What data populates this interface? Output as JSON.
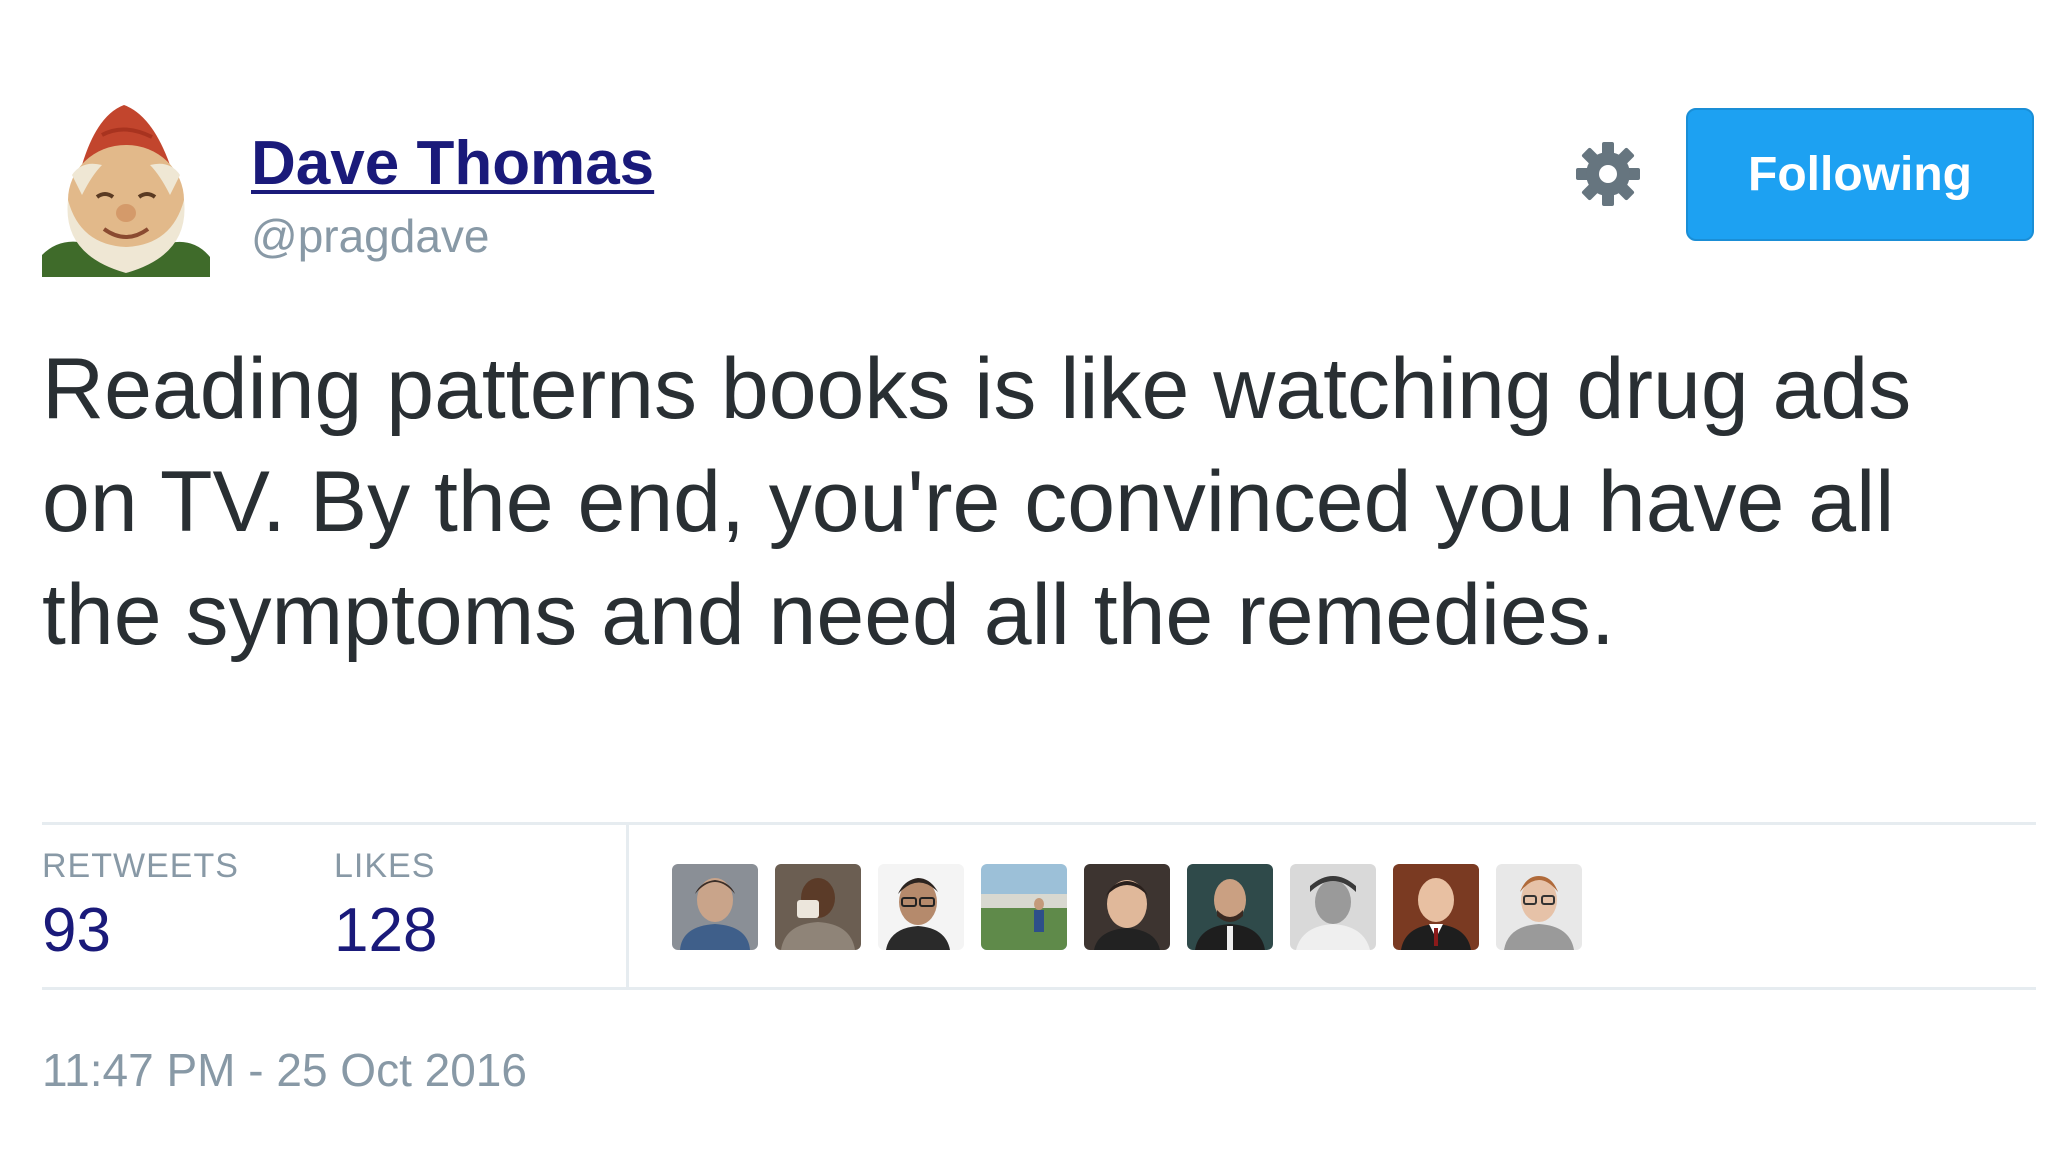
{
  "author": {
    "display_name": "Dave Thomas",
    "handle": "@pragdave",
    "avatar_icon": "garden-gnome-avatar"
  },
  "header": {
    "settings_icon": "gear-icon",
    "follow_button_label": "Following",
    "follow_button_color": "#1da1f2"
  },
  "tweet": {
    "text": "Reading patterns books is like watching drug ads on TV. By the end, you're convinced you have all the symptoms and need all the remedies."
  },
  "stats": {
    "retweets_label": "RETWEETS",
    "retweets_count": "93",
    "likes_label": "LIKES",
    "likes_count": "128"
  },
  "likers": [
    {
      "icon": "user-avatar-1"
    },
    {
      "icon": "user-avatar-2"
    },
    {
      "icon": "user-avatar-3"
    },
    {
      "icon": "user-avatar-4"
    },
    {
      "icon": "user-avatar-5"
    },
    {
      "icon": "user-avatar-6"
    },
    {
      "icon": "user-avatar-7"
    },
    {
      "icon": "user-avatar-8"
    },
    {
      "icon": "user-avatar-9"
    }
  ],
  "timestamp": "11:47 PM - 25 Oct 2016",
  "colors": {
    "name": "#1a1a7a",
    "muted": "#8899a6",
    "text": "#292f33",
    "accent": "#1da1f2"
  }
}
